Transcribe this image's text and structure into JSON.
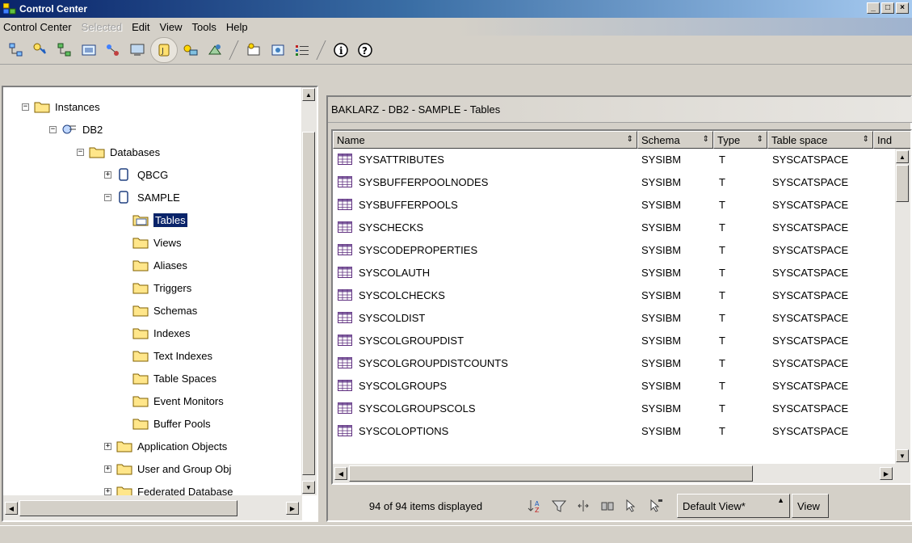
{
  "window": {
    "title": "Control Center"
  },
  "menu": [
    {
      "label": "Control Center",
      "disabled": false
    },
    {
      "label": "Selected",
      "disabled": true
    },
    {
      "label": "Edit",
      "disabled": false
    },
    {
      "label": "View",
      "disabled": false
    },
    {
      "label": "Tools",
      "disabled": false
    },
    {
      "label": "Help",
      "disabled": false
    }
  ],
  "tree": {
    "items": [
      {
        "label": "Instances",
        "icon": "folder-icon",
        "expander": "−"
      },
      {
        "label": "DB2",
        "icon": "instance-icon",
        "expander": "−"
      },
      {
        "label": "Databases",
        "icon": "folder-icon",
        "expander": "−"
      },
      {
        "label": "QBCG",
        "icon": "database-icon",
        "expander": "+"
      },
      {
        "label": "SAMPLE",
        "icon": "database-icon",
        "expander": "−"
      },
      {
        "label": "Tables",
        "icon": "tables-folder-icon",
        "selected": true
      },
      {
        "label": "Views",
        "icon": "folder-icon"
      },
      {
        "label": "Aliases",
        "icon": "folder-icon"
      },
      {
        "label": "Triggers",
        "icon": "folder-icon"
      },
      {
        "label": "Schemas",
        "icon": "folder-icon"
      },
      {
        "label": "Indexes",
        "icon": "folder-icon"
      },
      {
        "label": "Text Indexes",
        "icon": "folder-icon"
      },
      {
        "label": "Table Spaces",
        "icon": "folder-icon"
      },
      {
        "label": "Event Monitors",
        "icon": "folder-icon"
      },
      {
        "label": "Buffer Pools",
        "icon": "folder-icon"
      },
      {
        "label": "Application Objects",
        "icon": "folder-icon",
        "expander": "+"
      },
      {
        "label": "User and Group Obj",
        "icon": "folder-icon",
        "expander": "+"
      },
      {
        "label": "Federated Database",
        "icon": "folder-icon",
        "expander": "+"
      }
    ]
  },
  "main": {
    "breadcrumb": "BAKLARZ - DB2 - SAMPLE - Tables",
    "columns": [
      "Name",
      "Schema",
      "Type",
      "Table space",
      "Ind"
    ],
    "rows": [
      {
        "name": "SYSATTRIBUTES",
        "schema": "SYSIBM",
        "type": "T",
        "tablespace": "SYSCATSPACE"
      },
      {
        "name": "SYSBUFFERPOOLNODES",
        "schema": "SYSIBM",
        "type": "T",
        "tablespace": "SYSCATSPACE"
      },
      {
        "name": "SYSBUFFERPOOLS",
        "schema": "SYSIBM",
        "type": "T",
        "tablespace": "SYSCATSPACE"
      },
      {
        "name": "SYSCHECKS",
        "schema": "SYSIBM",
        "type": "T",
        "tablespace": "SYSCATSPACE"
      },
      {
        "name": "SYSCODEPROPERTIES",
        "schema": "SYSIBM",
        "type": "T",
        "tablespace": "SYSCATSPACE"
      },
      {
        "name": "SYSCOLAUTH",
        "schema": "SYSIBM",
        "type": "T",
        "tablespace": "SYSCATSPACE"
      },
      {
        "name": "SYSCOLCHECKS",
        "schema": "SYSIBM",
        "type": "T",
        "tablespace": "SYSCATSPACE"
      },
      {
        "name": "SYSCOLDIST",
        "schema": "SYSIBM",
        "type": "T",
        "tablespace": "SYSCATSPACE"
      },
      {
        "name": "SYSCOLGROUPDIST",
        "schema": "SYSIBM",
        "type": "T",
        "tablespace": "SYSCATSPACE"
      },
      {
        "name": "SYSCOLGROUPDISTCOUNTS",
        "schema": "SYSIBM",
        "type": "T",
        "tablespace": "SYSCATSPACE"
      },
      {
        "name": "SYSCOLGROUPS",
        "schema": "SYSIBM",
        "type": "T",
        "tablespace": "SYSCATSPACE"
      },
      {
        "name": "SYSCOLGROUPSCOLS",
        "schema": "SYSIBM",
        "type": "T",
        "tablespace": "SYSCATSPACE"
      },
      {
        "name": "SYSCOLOPTIONS",
        "schema": "SYSIBM",
        "type": "T",
        "tablespace": "SYSCATSPACE"
      }
    ],
    "status": "94 of 94 items displayed",
    "view_name": "Default View*",
    "view_button": "View"
  },
  "colors": {
    "selection": "#0a246a",
    "title_start": "#0a246a",
    "title_end": "#a6caf0"
  }
}
